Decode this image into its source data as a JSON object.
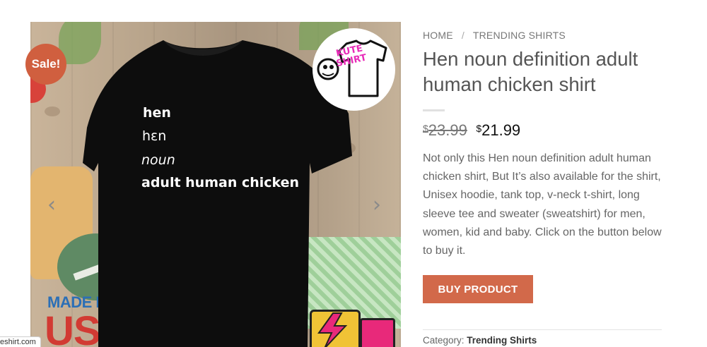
{
  "product": {
    "sale_badge": "Sale!",
    "shirt_print": [
      "hen",
      "hɛn",
      "noun",
      "adult human chicken"
    ],
    "logo_text_line1": "KUTE",
    "logo_text_line2": "SHIRT",
    "background_text_line1": "MADE IN THE",
    "background_text_line2": "USA",
    "prev_arrow": "‹",
    "next_arrow": "›"
  },
  "url_chip": "eshirt.com",
  "breadcrumb": {
    "home": "HOME",
    "separator": "/",
    "section": "TRENDING SHIRTS"
  },
  "title": "Hen noun definition adult human chicken shirt",
  "price": {
    "currency": "$",
    "old": "23.99",
    "new": "21.99"
  },
  "description": "Not only this Hen noun definition adult human chicken shirt, But It’s also available for the shirt, Unisex hoodie, tank top, v-neck t-shirt, long sleeve tee and sweater (sweatshirt) for men, women, kid and baby. Click on the button below to buy it.",
  "buy_button": "BUY PRODUCT",
  "category": {
    "label": "Category:",
    "value": "Trending Shirts"
  },
  "colors": {
    "sale_badge": "#d05f3f",
    "buy_button": "#d2694a",
    "logo_pink": "#e82bb8",
    "shirt": "#0d0d0d"
  }
}
